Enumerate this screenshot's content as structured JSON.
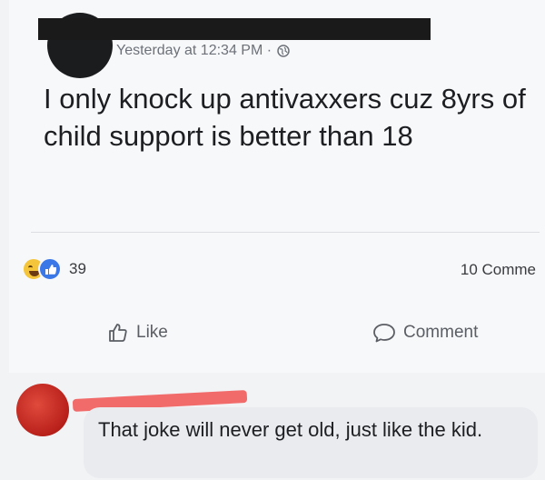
{
  "post": {
    "timestamp": "Yesterday at 12:34 PM ·",
    "text": "I only knock up antivaxxers cuz 8yrs of child support is better than 18"
  },
  "reactions": {
    "count": "39"
  },
  "comments_summary": "10 Comme",
  "actions": {
    "like_label": "Like",
    "comment_label": "Comment"
  },
  "comment": {
    "text": "That joke will never get old, just like the kid."
  },
  "colors": {
    "like_blue": "#3b78e7",
    "haha_yellow": "#f4c53a",
    "redaction_red": "#f26b6b"
  }
}
